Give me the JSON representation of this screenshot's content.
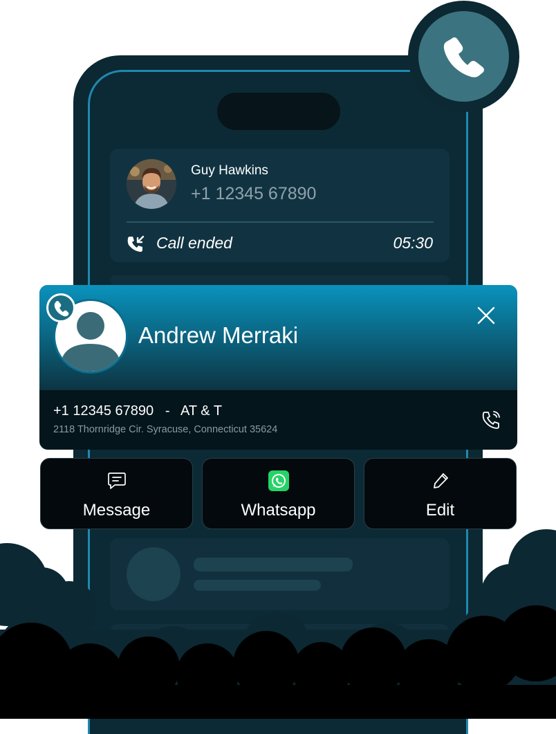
{
  "call_card": {
    "name": "Guy Hawkins",
    "number": "+1 12345 67890",
    "status": "Call ended",
    "duration": "05:30"
  },
  "contact_popup": {
    "name": "Andrew Merraki",
    "number_line": "+1 12345 67890   -   AT & T",
    "address": "2118 Thornridge Cir. Syracuse, Connecticut 35624"
  },
  "actions": [
    {
      "label": "Message",
      "icon": "message-icon"
    },
    {
      "label": "Whatsapp",
      "icon": "whatsapp-icon"
    },
    {
      "label": "Edit",
      "icon": "edit-icon"
    }
  ],
  "colors": {
    "phone_body": "#0c2833",
    "accent": "#0a93bd",
    "whatsapp": "#25d366"
  }
}
